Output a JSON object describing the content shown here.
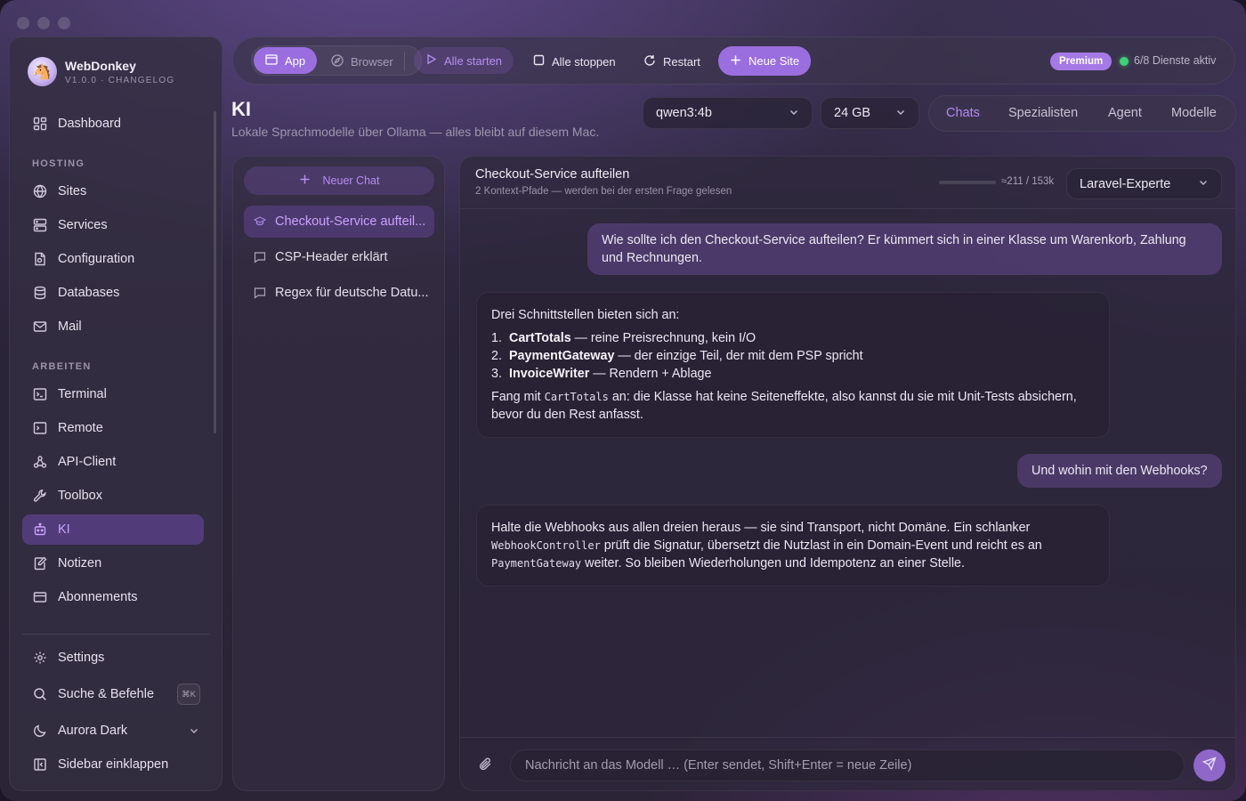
{
  "app": {
    "name": "WebDonkey",
    "version": "V1.0.0",
    "changelog": "CHANGELOG"
  },
  "sidebar": {
    "top_item": {
      "label": "Dashboard",
      "icon": "dashboard-icon"
    },
    "sections": [
      {
        "title": "HOSTING",
        "items": [
          {
            "label": "Sites",
            "icon": "globe-icon"
          },
          {
            "label": "Services",
            "icon": "server-icon"
          },
          {
            "label": "Configuration",
            "icon": "config-file-icon"
          },
          {
            "label": "Databases",
            "icon": "database-icon"
          },
          {
            "label": "Mail",
            "icon": "mail-icon"
          }
        ]
      },
      {
        "title": "ARBEITEN",
        "items": [
          {
            "label": "Terminal",
            "icon": "terminal-icon"
          },
          {
            "label": "Remote",
            "icon": "remote-terminal-icon"
          },
          {
            "label": "API-Client",
            "icon": "webhook-icon"
          },
          {
            "label": "Toolbox",
            "icon": "wrench-icon"
          },
          {
            "label": "KI",
            "icon": "bot-icon",
            "active": true
          },
          {
            "label": "Notizen",
            "icon": "notes-icon"
          },
          {
            "label": "Abonnements",
            "icon": "card-icon"
          }
        ]
      }
    ],
    "bottom": {
      "settings": "Settings",
      "search": "Suche & Befehle",
      "search_shortcut": "⌘K",
      "theme": "Aurora Dark",
      "collapse": "Sidebar einklappen"
    }
  },
  "toolbar": {
    "app_label": "App",
    "browser_label": "Browser",
    "start_all": "Alle starten",
    "stop_all": "Alle stoppen",
    "restart": "Restart",
    "new_site": "Neue Site",
    "premium": "Premium",
    "status": "6/8 Dienste aktiv",
    "status_color": "#3fd07a",
    "accent": "#9b6ee0"
  },
  "page": {
    "title": "KI",
    "subtitle": "Lokale Sprachmodelle über Ollama — alles bleibt auf diesem Mac.",
    "model": "qwen3:4b",
    "memory": "24 GB",
    "tabs": [
      {
        "label": "Chats",
        "active": true
      },
      {
        "label": "Spezialisten"
      },
      {
        "label": "Agent"
      },
      {
        "label": "Modelle"
      }
    ]
  },
  "chats": {
    "new_chat": "Neuer Chat",
    "items": [
      {
        "label": "Checkout-Service aufteil...",
        "active": true
      },
      {
        "label": "CSP-Header erklärt"
      },
      {
        "label": "Regex für deutsche Datu..."
      }
    ]
  },
  "conversation": {
    "title": "Checkout-Service aufteilen",
    "subtitle": "2 Kontext-Pfade — werden bei der ersten Frage gelesen",
    "context_usage": "≈211 / 153k",
    "specialist": "Laravel-Experte",
    "messages": {
      "m1": "Wie sollte ich den Checkout-Service aufteilen? Er kümmert sich in einer Klasse um Warenkorb, Zahlung und Rechnungen.",
      "m2_intro": "Drei Schnittstellen bieten sich an:",
      "m2_list": [
        {
          "n": "1.",
          "name": "CartTotals",
          "desc": " — reine Preisrechnung, kein I/O"
        },
        {
          "n": "2.",
          "name": "PaymentGateway",
          "desc": " — der einzige Teil, der mit dem PSP spricht"
        },
        {
          "n": "3.",
          "name": "InvoiceWriter",
          "desc": " — Rendern + Ablage"
        }
      ],
      "m2_outro_a": "Fang mit ",
      "m2_outro_code": "CartTotals",
      "m2_outro_b": " an: die Klasse hat keine Seiteneffekte, also kannst du sie mit Unit-Tests absichern, bevor du den Rest anfasst.",
      "m3": "Und wohin mit den Webhooks?",
      "m4_a": "Halte die Webhooks aus allen dreien heraus — sie sind Transport, nicht Domäne. Ein schlanker ",
      "m4_code1": "WebhookController",
      "m4_b": " prüft die Signatur, übersetzt die Nutzlast in ein Domain-Event und reicht es an ",
      "m4_code2": "PaymentGateway",
      "m4_c": " weiter. So bleiben Wiederholungen und Idempotenz an einer Stelle."
    },
    "input_placeholder": "Nachricht an das Modell … (Enter sendet, Shift+Enter = neue Zeile)"
  }
}
